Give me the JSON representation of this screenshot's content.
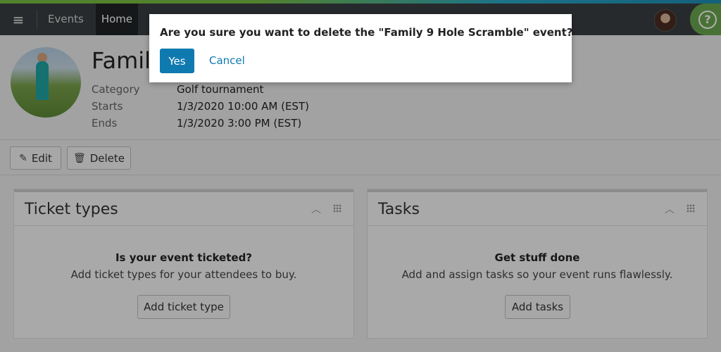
{
  "header": {
    "menu_icon": "menu-icon",
    "nav_events": "Events",
    "nav_home": "Home",
    "help_label": "?"
  },
  "event": {
    "title": "Family 9 Hole Scramble",
    "fields": [
      {
        "label": "Category",
        "value": "Golf tournament"
      },
      {
        "label": "Starts",
        "value": "1/3/2020 10:00 AM (EST)"
      },
      {
        "label": "Ends",
        "value": "1/3/2020 3:00 PM (EST)"
      }
    ]
  },
  "actions": {
    "edit": "Edit",
    "delete": "Delete"
  },
  "panels": [
    {
      "title": "Ticket types",
      "heading": "Is your event ticketed?",
      "text": "Add ticket types for your attendees to buy.",
      "button": "Add ticket type"
    },
    {
      "title": "Tasks",
      "heading": "Get stuff done",
      "text": "Add and assign tasks so your event runs flawlessly.",
      "button": "Add tasks"
    }
  ],
  "dialog": {
    "message": "Are you sure you want to delete the \"Family 9 Hole Scramble\" event?",
    "yes": "Yes",
    "cancel": "Cancel"
  },
  "colors": {
    "header_bg": "#3a3e42",
    "primary": "#0f7ab0",
    "help_green": "#6aa84f"
  }
}
